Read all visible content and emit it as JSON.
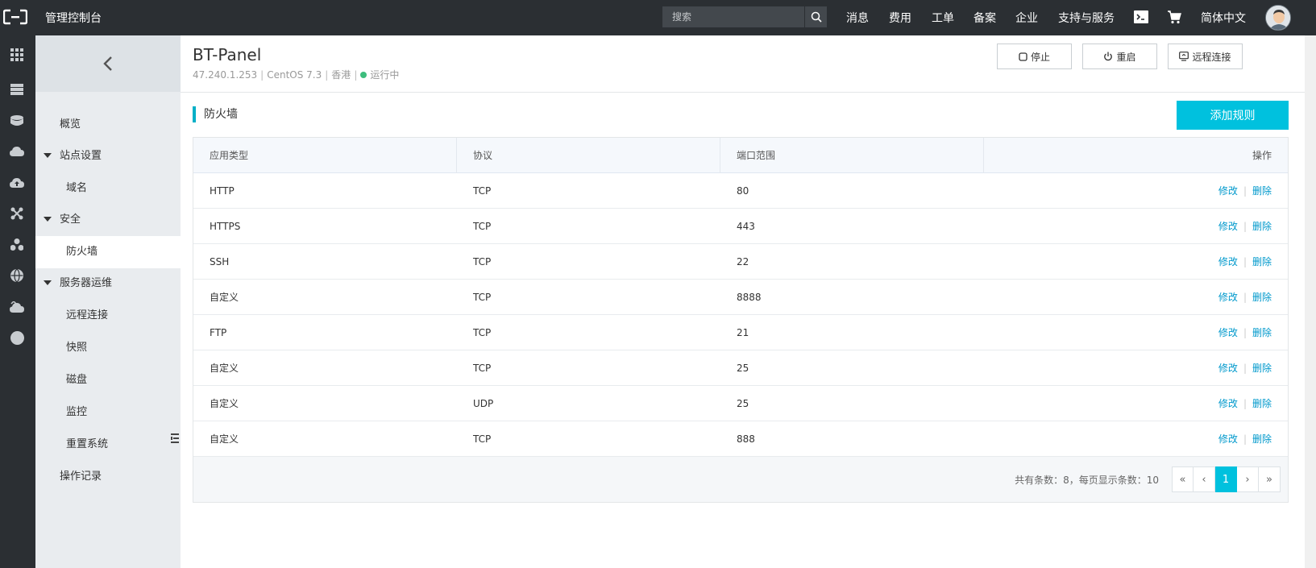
{
  "topbar": {
    "brand": "管理控制台",
    "search_placeholder": "搜索",
    "nav": [
      "消息",
      "费用",
      "工单",
      "备案",
      "企业",
      "支持与服务"
    ],
    "language": "简体中文"
  },
  "sidebar": {
    "items": [
      {
        "label": "概览",
        "level": 1
      },
      {
        "label": "站点设置",
        "level": 1
      },
      {
        "label": "域名",
        "level": 2
      },
      {
        "label": "安全",
        "level": 1
      },
      {
        "label": "防火墙",
        "level": 2
      },
      {
        "label": "服务器运维",
        "level": 1
      },
      {
        "label": "远程连接",
        "level": 2
      },
      {
        "label": "快照",
        "level": 2
      },
      {
        "label": "磁盘",
        "level": 2
      },
      {
        "label": "监控",
        "level": 2
      },
      {
        "label": "重置系统",
        "level": 2
      },
      {
        "label": "操作记录",
        "level": 1
      }
    ]
  },
  "instance": {
    "name": "BT-Panel",
    "ip": "47.240.1.253",
    "os": "CentOS 7.3",
    "region": "香港",
    "status": "运行中",
    "status_color": "#3dbd7d"
  },
  "header_buttons": {
    "stop": "停止",
    "restart": "重启",
    "remote": "远程连接"
  },
  "section": {
    "title": "防火墙",
    "add_button": "添加规则",
    "accent": "#00c1de"
  },
  "table": {
    "columns": [
      "应用类型",
      "协议",
      "端口范围",
      "操作"
    ],
    "rows": [
      {
        "app": "HTTP",
        "protocol": "TCP",
        "port": "80"
      },
      {
        "app": "HTTPS",
        "protocol": "TCP",
        "port": "443"
      },
      {
        "app": "SSH",
        "protocol": "TCP",
        "port": "22"
      },
      {
        "app": "自定义",
        "protocol": "TCP",
        "port": "8888"
      },
      {
        "app": "FTP",
        "protocol": "TCP",
        "port": "21"
      },
      {
        "app": "自定义",
        "protocol": "TCP",
        "port": "25"
      },
      {
        "app": "自定义",
        "protocol": "UDP",
        "port": "25"
      },
      {
        "app": "自定义",
        "protocol": "TCP",
        "port": "888"
      }
    ],
    "edit_label": "修改",
    "delete_label": "删除"
  },
  "pagination": {
    "info": "共有条数：8，每页显示条数：10",
    "first": "«",
    "prev": "‹",
    "current": "1",
    "next": "›",
    "last": "»"
  }
}
